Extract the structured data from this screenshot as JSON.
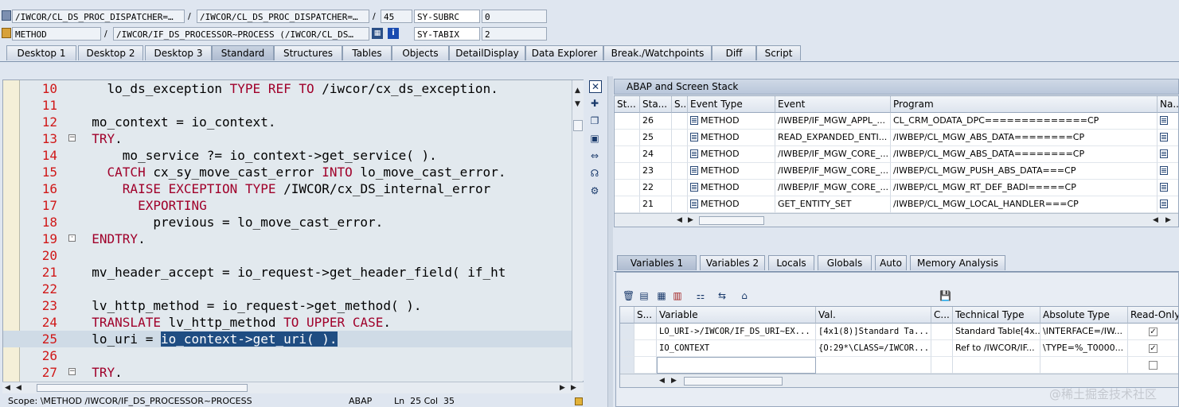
{
  "top": {
    "row1": {
      "field1": "/IWCOR/CL_DS_PROC_DISPATCHER=…",
      "sep1": "/",
      "field2": "/IWCOR/CL_DS_PROC_DISPATCHER=…",
      "sep2": "/",
      "line": "45",
      "sysvar": "SY-SUBRC",
      "sysval": "0"
    },
    "row2": {
      "type": "METHOD",
      "sep1": "/",
      "name": "/IWCOR/IF_DS_PROCESSOR~PROCESS (/IWCOR/CL_DS…",
      "sysvar": "SY-TABIX",
      "sysval": "2"
    }
  },
  "tabs": [
    "Desktop 1",
    "Desktop 2",
    "Desktop 3",
    "Standard",
    "Structures",
    "Tables",
    "Objects",
    "DetailDisplay",
    "Data Explorer",
    "Break./Watchpoints",
    "Diff",
    "Script"
  ],
  "active_tab": "Standard",
  "code": {
    "lines": [
      {
        "n": "10",
        "t": "    lo_ds_exception TYPE REF TO /iwcor/cx_ds_exception."
      },
      {
        "n": "11",
        "t": ""
      },
      {
        "n": "12",
        "t": "  mo_context = io_context."
      },
      {
        "n": "13",
        "t": "  TRY."
      },
      {
        "n": "14",
        "t": "      mo_service ?= io_context->get_service( )."
      },
      {
        "n": "15",
        "t": "    CATCH cx_sy_move_cast_error INTO lo_move_cast_error."
      },
      {
        "n": "16",
        "t": "      RAISE EXCEPTION TYPE /IWCOR/cx_DS_internal_error"
      },
      {
        "n": "17",
        "t": "        EXPORTING"
      },
      {
        "n": "18",
        "t": "          previous = lo_move_cast_error."
      },
      {
        "n": "19",
        "t": "  ENDTRY."
      },
      {
        "n": "20",
        "t": ""
      },
      {
        "n": "21",
        "t": "  mv_header_accept = io_request->get_header_field( if_ht"
      },
      {
        "n": "22",
        "t": ""
      },
      {
        "n": "23",
        "t": "  lv_http_method = io_request->get_method( )."
      },
      {
        "n": "24",
        "t": "  TRANSLATE lv_http_method TO UPPER CASE."
      },
      {
        "n": "25",
        "t": "  lo_uri = io_context->get_uri( )."
      },
      {
        "n": "26",
        "t": ""
      },
      {
        "n": "27",
        "t": "  TRY."
      }
    ],
    "selected_text": "io_context->get_uri( )."
  },
  "status": {
    "scope": "Scope: \\METHOD /IWCOR/IF_DS_PROCESSOR~PROCESS",
    "lang": "ABAP",
    "pos": "Ln  25 Col  35"
  },
  "stack": {
    "title": "ABAP and Screen Stack",
    "headers": [
      "St...",
      "Sta...",
      "S...",
      "Event Type",
      "Event",
      "Program",
      "Na..."
    ],
    "rows": [
      {
        "level": "26",
        "type": "METHOD",
        "event": "/IWBEP/IF_MGW_APPL_...",
        "program": "CL_CRM_ODATA_DPC==============CP"
      },
      {
        "level": "25",
        "type": "METHOD",
        "event": "READ_EXPANDED_ENTI...",
        "program": "/IWBEP/CL_MGW_ABS_DATA========CP"
      },
      {
        "level": "24",
        "type": "METHOD",
        "event": "/IWBEP/IF_MGW_CORE_...",
        "program": "/IWBEP/CL_MGW_ABS_DATA========CP"
      },
      {
        "level": "23",
        "type": "METHOD",
        "event": "/IWBEP/IF_MGW_CORE_...",
        "program": "/IWBEP/CL_MGW_PUSH_ABS_DATA===CP"
      },
      {
        "level": "22",
        "type": "METHOD",
        "event": "/IWBEP/IF_MGW_CORE_...",
        "program": "/IWBEP/CL_MGW_RT_DEF_BADI=====CP"
      },
      {
        "level": "21",
        "type": "METHOD",
        "event": "GET_ENTITY_SET",
        "program": "/IWBEP/CL_MGW_LOCAL_HANDLER===CP"
      }
    ]
  },
  "vars": {
    "tabs": [
      "Variables 1",
      "Variables 2",
      "Locals",
      "Globals",
      "Auto",
      "Memory Analysis"
    ],
    "active_tab": "Variables 1",
    "headers": [
      "S...",
      "Variable",
      "Val.",
      "C...",
      "Technical Type",
      "Absolute Type",
      "Read-Only"
    ],
    "rows": [
      {
        "variable": "LO_URI->/IWCOR/IF_DS_URI~EX...",
        "value": "[4x1(8)]Standard Ta...",
        "tech": "Standard Table[4x...",
        "abs": "\\INTERFACE=/IW...",
        "ro": true
      },
      {
        "variable": "IO_CONTEXT",
        "value": "{O:29*\\CLASS=/IWCOR...",
        "tech": "Ref to /IWCOR/IF...",
        "abs": "\\TYPE=%_T0000...",
        "ro": true
      },
      {
        "variable": "",
        "value": "",
        "tech": "",
        "abs": "",
        "ro": false
      }
    ]
  },
  "watermark": "@稀土掘金技术社区",
  "colors": {
    "keyword": "#a0002a",
    "line_number": "#d01818",
    "selection": "#1f4d82",
    "editor_bg": "#e2e9ee"
  },
  "icons": [
    "close-icon",
    "new-breakpoint-icon",
    "copy-icon",
    "screen-icon",
    "resize-icon",
    "headset-icon",
    "settings-icon",
    "delete-icon",
    "print-icon",
    "save-icon"
  ]
}
